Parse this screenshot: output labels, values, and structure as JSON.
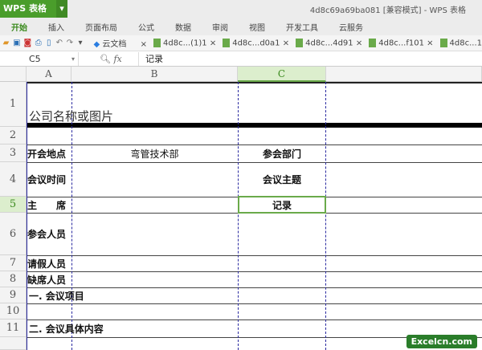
{
  "app": {
    "logo": "WPS 表格",
    "window_title": "4d8c69a69ba081 [兼容模式] - WPS 表格"
  },
  "ribbon": [
    "开始",
    "插入",
    "页面布局",
    "公式",
    "数据",
    "审阅",
    "视图",
    "开发工具",
    "云服务"
  ],
  "tabs": [
    "云文档",
    "4d8c...(1)1",
    "4d8c...d0a1",
    "4d8c...4d91",
    "4d8c...f101",
    "4d8c...1"
  ],
  "formula": {
    "cell_ref": "C5",
    "fx": "fx",
    "value": "记录"
  },
  "columns": [
    "A",
    "B",
    "C"
  ],
  "rows": [
    "1",
    "2",
    "3",
    "4",
    "5",
    "6",
    "7",
    "8",
    "9",
    "10",
    "11"
  ],
  "cells": {
    "r1": "公司名称或图片",
    "r3a": "开会地点",
    "r3b": "弯管技术部",
    "r3c": "参会部门",
    "r4a": "会议时间",
    "r4c": "会议主题",
    "r5a": "主　　席",
    "r5c": "记录",
    "r6a": "参会人员",
    "r7a": "请假人员",
    "r8a": "缺席人员",
    "r9a": "一. 会议项目",
    "r11a": "二. 会议具体内容"
  },
  "watermark": "Excelcn.com"
}
